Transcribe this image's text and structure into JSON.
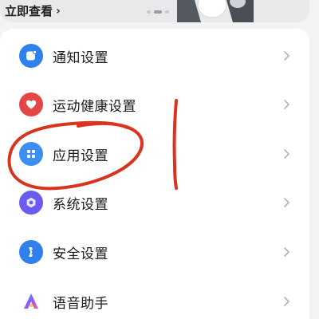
{
  "banner": {
    "link_label": "立即查看",
    "chevron_glyph": "›",
    "carousel_active_index": 1
  },
  "settings": {
    "items": [
      {
        "label": "通知设置",
        "icon": "notification-icon",
        "color": "#2f80ed"
      },
      {
        "label": "运动健康设置",
        "icon": "heart-icon",
        "color": "#e64545"
      },
      {
        "label": "应用设置",
        "icon": "apps-grid-icon",
        "color": "#3c8ff2"
      },
      {
        "label": "系统设置",
        "icon": "system-icon",
        "color": "#6b5cf0"
      },
      {
        "label": "安全设置",
        "icon": "security-icon",
        "color": "#2f80ed"
      },
      {
        "label": "语音助手",
        "icon": "voice-assistant-icon",
        "color": "#7b5cff"
      }
    ]
  },
  "annotation": {
    "color": "#d8341f",
    "highlighted_item": "应用设置"
  }
}
